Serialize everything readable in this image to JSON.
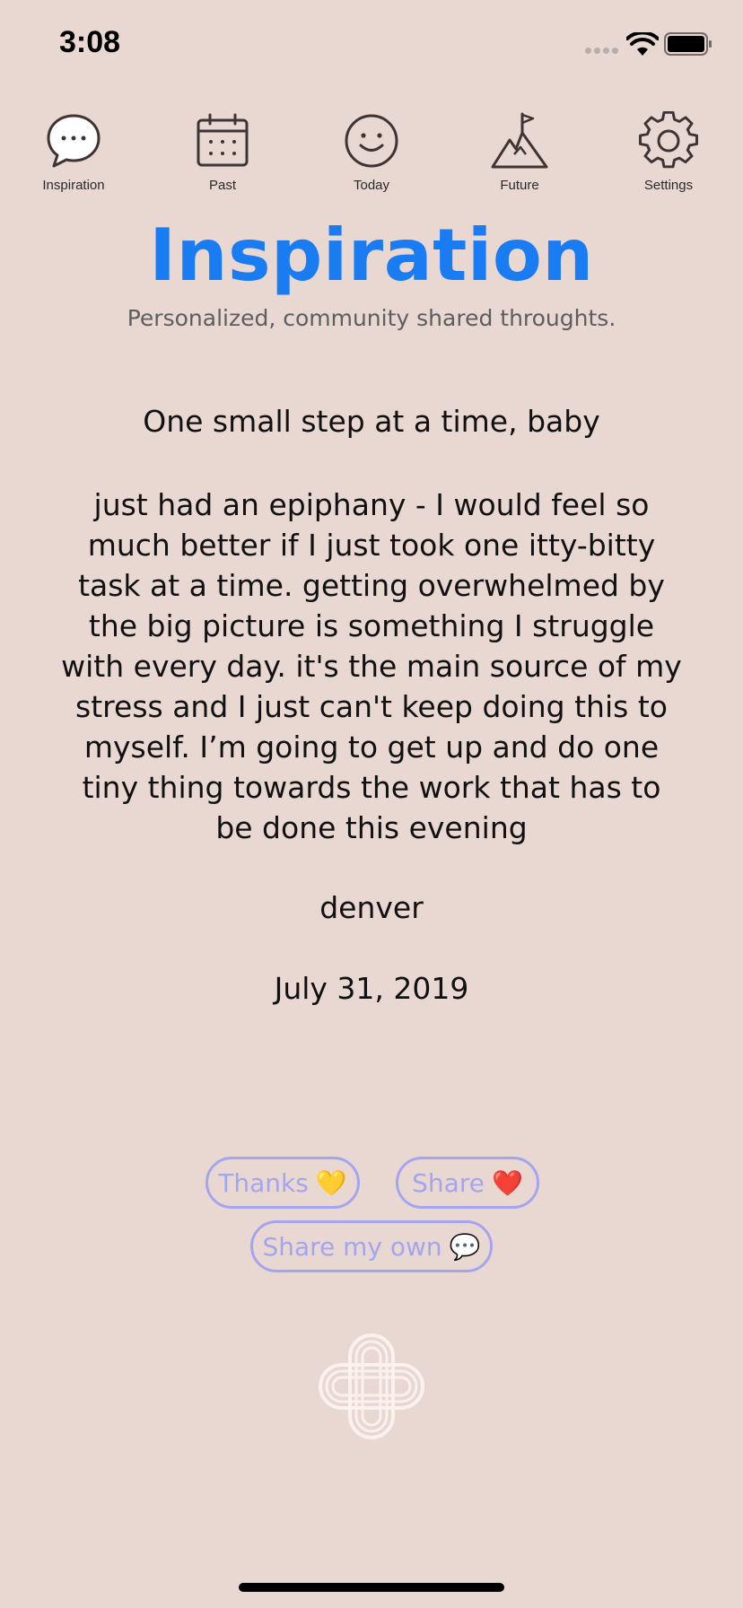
{
  "status_bar": {
    "time": "3:08"
  },
  "nav": {
    "items": [
      {
        "label": "Inspiration",
        "icon": "speech-bubble-icon"
      },
      {
        "label": "Past",
        "icon": "calendar-icon"
      },
      {
        "label": "Today",
        "icon": "smiley-icon"
      },
      {
        "label": "Future",
        "icon": "mountain-flag-icon"
      },
      {
        "label": "Settings",
        "icon": "gear-icon"
      }
    ]
  },
  "header": {
    "title": "Inspiration",
    "subtitle": "Personalized, community shared throughts."
  },
  "post": {
    "title": "One small step at a time, baby",
    "body": "just had an epiphany - I would feel so much better if I just took one itty-bitty task at a time. getting overwhelmed by the big picture is something I struggle with every day.  it's the main source of my stress and I just can't keep doing this to myself. I’m going to get up and do one tiny thing towards the work that has to be done this evening",
    "author": "denver",
    "date": "July 31, 2019"
  },
  "actions": {
    "thanks_label": "Thanks",
    "thanks_emoji": "💛",
    "share_label": "Share",
    "share_emoji": "❤️",
    "share_own_label": "Share my own",
    "share_own_emoji": "💬"
  },
  "colors": {
    "background": "#E9D7D2",
    "accent": "#1A7CF2",
    "button_outline": "#A3A6EE",
    "icon_stroke": "#3E3434"
  }
}
